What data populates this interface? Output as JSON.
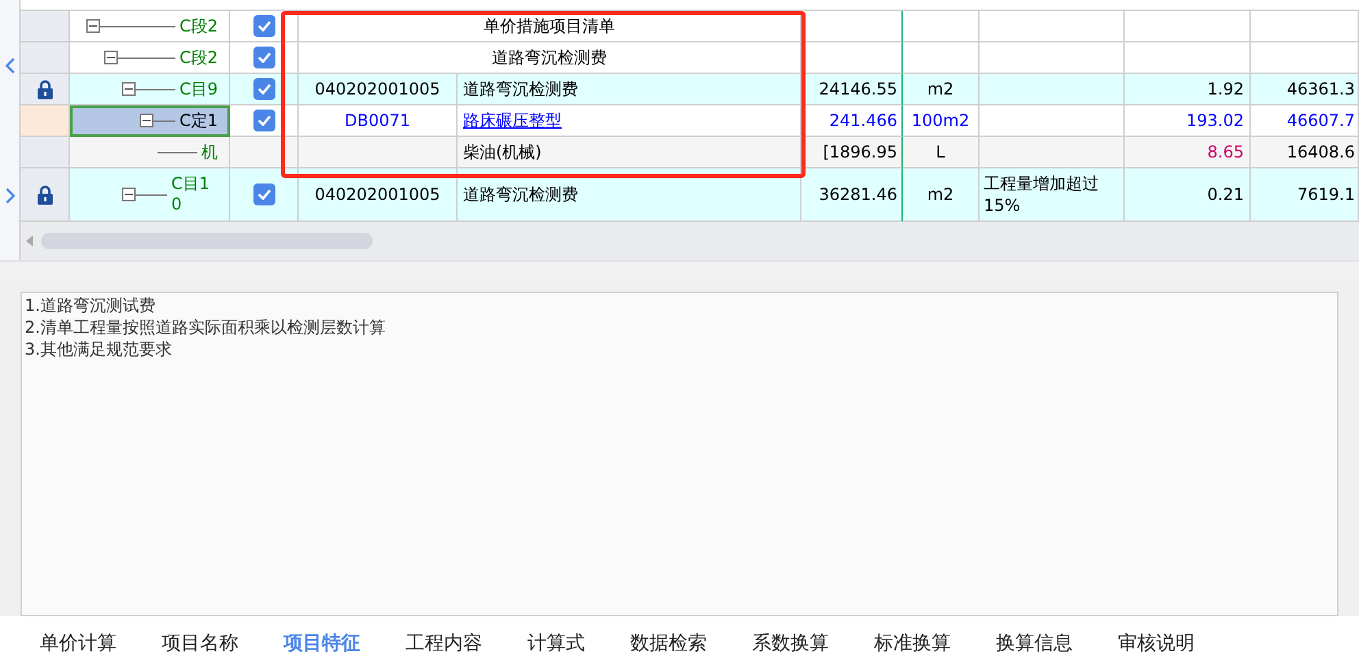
{
  "tree_rows": [
    {
      "kind": "section",
      "label": "C段2",
      "expanded": true,
      "locked": false,
      "checked": true,
      "selected": false,
      "name": "单价措施项目清单",
      "children": [
        {
          "kind": "section",
          "label": "C段2",
          "expanded": true,
          "locked": false,
          "checked": true,
          "selected": false,
          "name": "道路弯沉检测费",
          "children": [
            {
              "kind": "item",
              "label": "C目9",
              "expanded": true,
              "locked": true,
              "checked": true,
              "selected": false,
              "code": "040202001005",
              "name": "道路弯沉检测费",
              "quantity": "24146.55",
              "unit": "m2",
              "price": "1.92",
              "total": "46361.3",
              "children": [
                {
                  "kind": "quota",
                  "label": "C定1",
                  "expanded": true,
                  "locked": false,
                  "checked": true,
                  "selected": true,
                  "code": "DB0071",
                  "name": "路床碾压整型",
                  "quantity": "241.466",
                  "unit": "100m2",
                  "price": "193.02",
                  "total": "46607.7",
                  "children": [
                    {
                      "kind": "resource",
                      "label": "机",
                      "locked": false,
                      "selected": false,
                      "name": "柴油(机械)",
                      "quantity": "[1896.95",
                      "unit": "L",
                      "price": "8.65",
                      "total": "16408.6"
                    }
                  ]
                }
              ]
            },
            {
              "kind": "item",
              "label": "C目10",
              "expanded": true,
              "locked": true,
              "checked": true,
              "selected": false,
              "code": "040202001005",
              "name": "道路弯沉检测费",
              "quantity": "36281.46",
              "unit": "m2",
              "note": "工程量增加超过15%",
              "price": "0.21",
              "total": "7619.1"
            }
          ]
        }
      ]
    }
  ],
  "description": {
    "lines": [
      "1.道路弯沉测试费",
      "2.清单工程量按照道路实际面积乘以检测层数计算",
      "3.其他满足规范要求"
    ]
  },
  "tabs": [
    {
      "label": "单价计算",
      "selected": false
    },
    {
      "label": "项目名称",
      "selected": false
    },
    {
      "label": "项目特征",
      "selected": true
    },
    {
      "label": "工程内容",
      "selected": false
    },
    {
      "label": "计算式",
      "selected": false
    },
    {
      "label": "数据检索",
      "selected": false
    },
    {
      "label": "系数换算",
      "selected": false
    },
    {
      "label": "标准换算",
      "selected": false
    },
    {
      "label": "换算信息",
      "selected": false
    },
    {
      "label": "审核说明",
      "selected": false
    }
  ]
}
